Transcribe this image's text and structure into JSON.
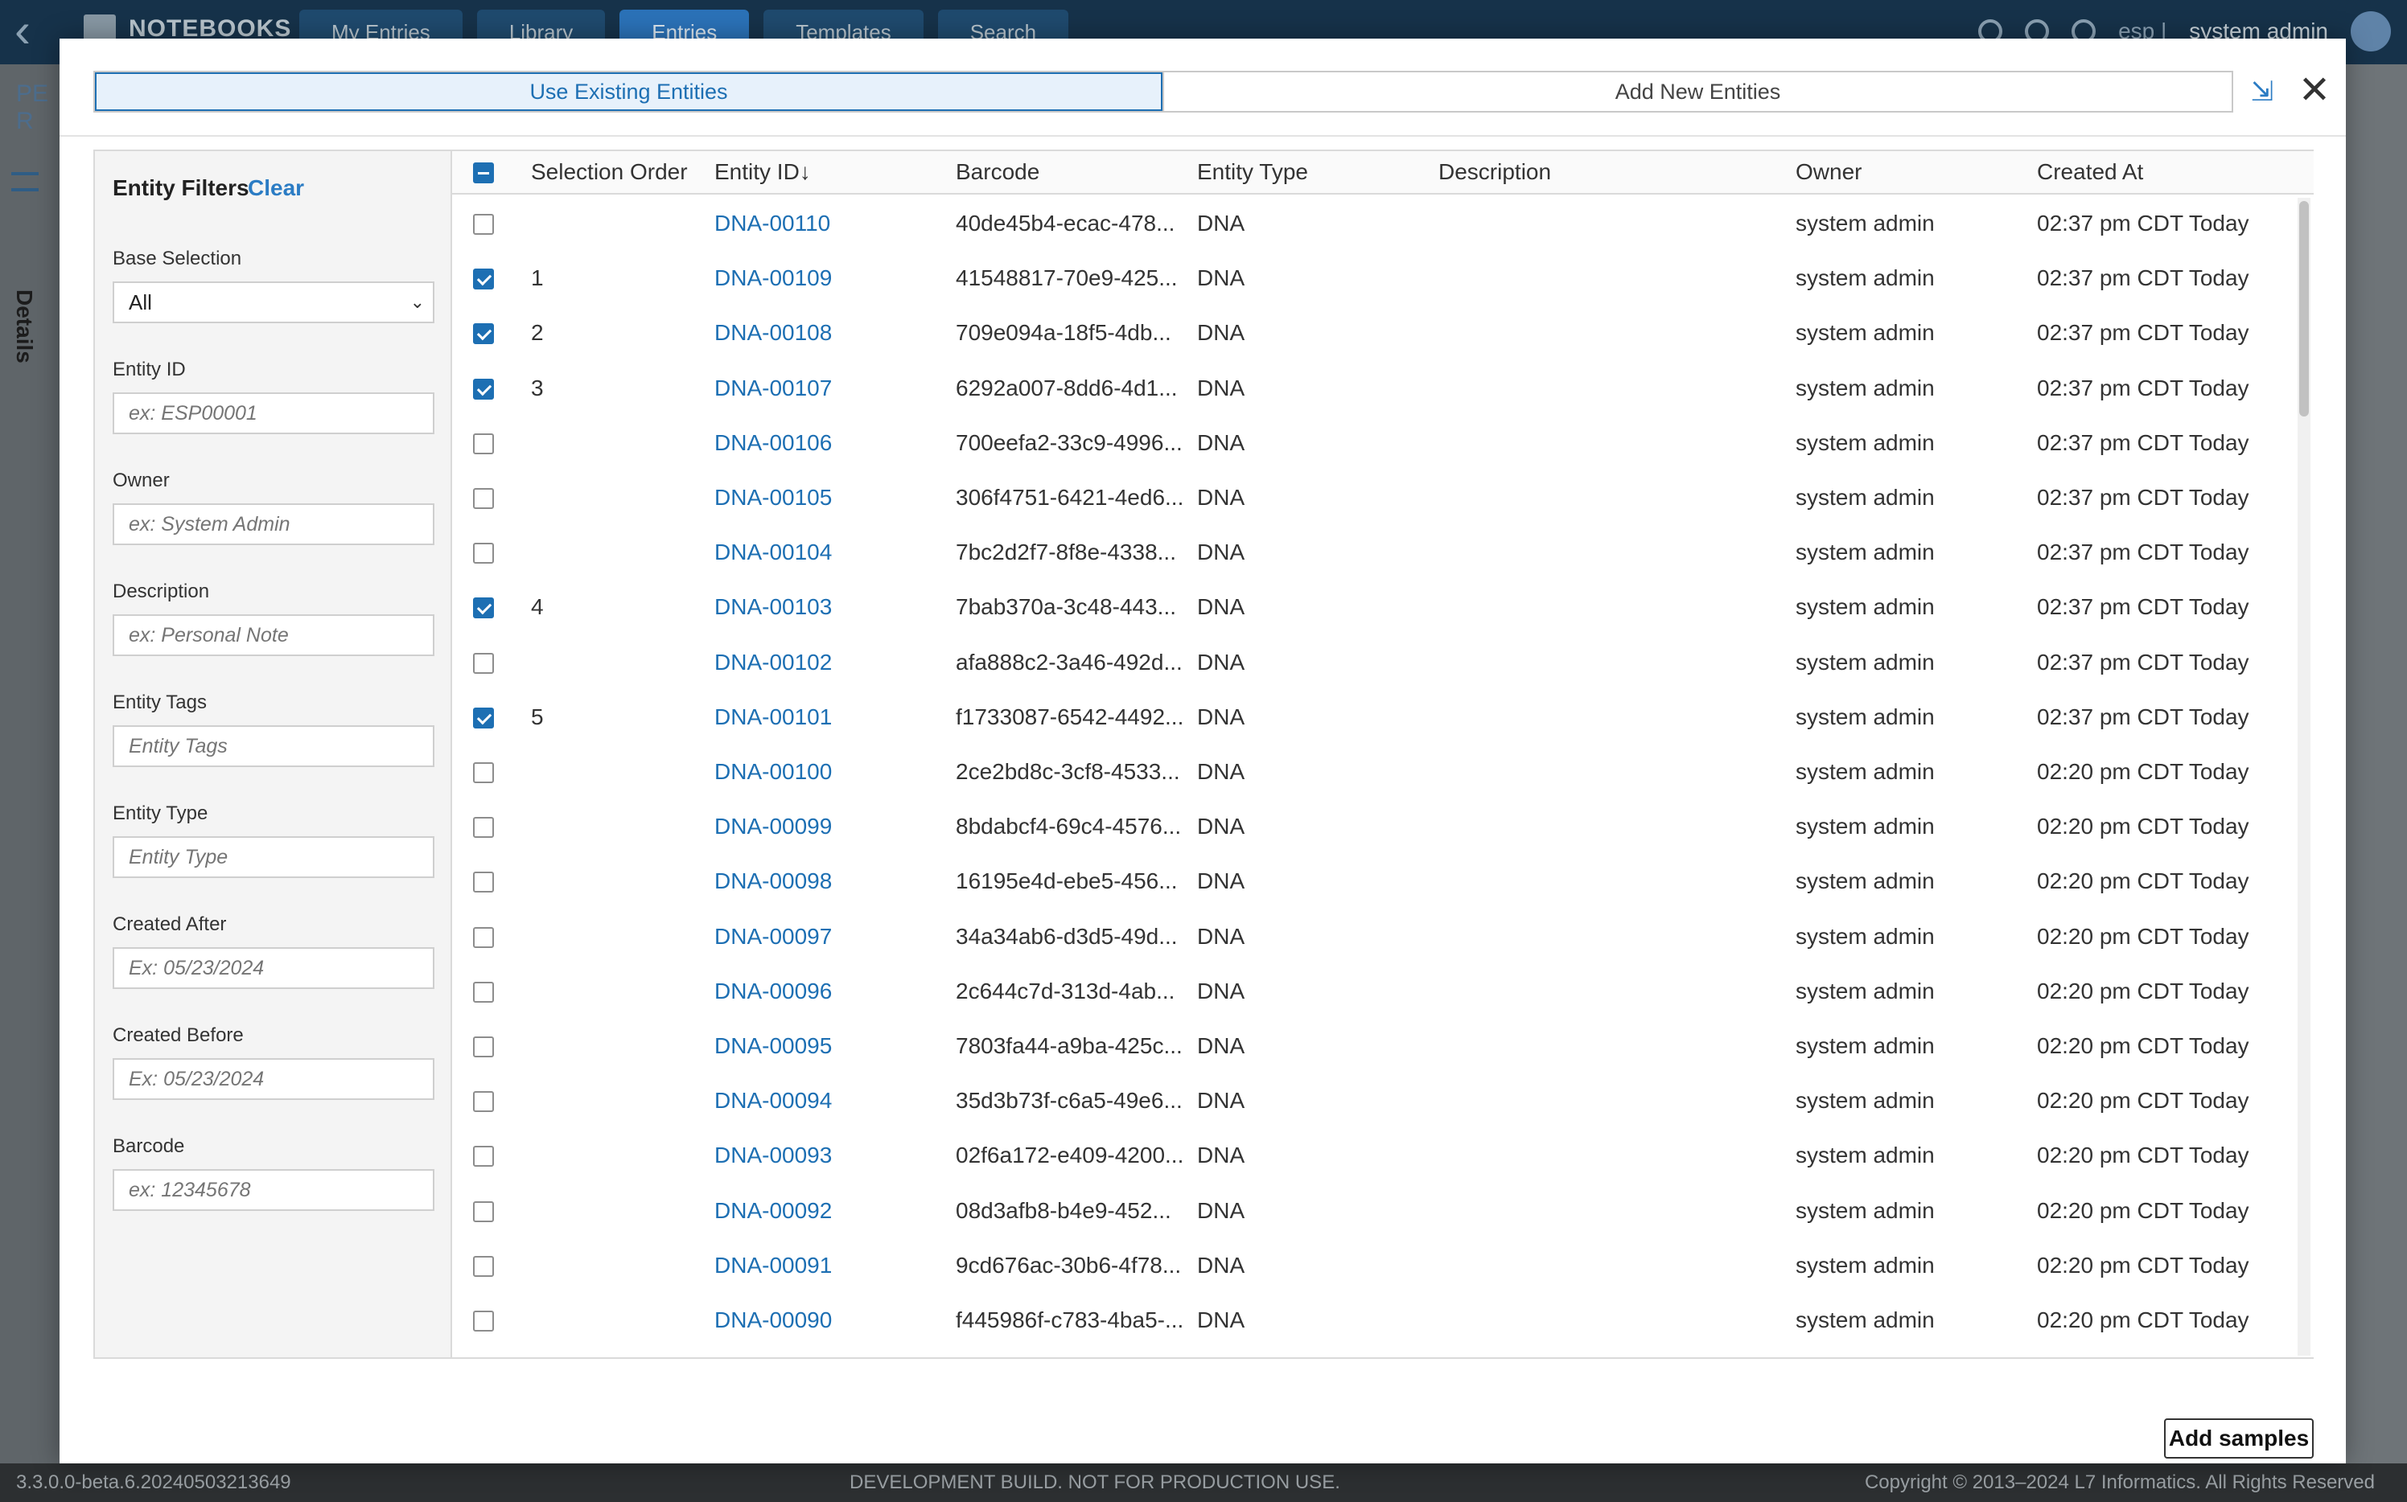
{
  "topbar": {
    "brand": "NOTEBOOKS",
    "tabs": [
      "My Entries",
      "Library",
      "Entries",
      "Templates",
      "Search"
    ],
    "active_tab": 2,
    "lang": "esp |",
    "user": "system admin"
  },
  "background": {
    "pe_label": "PE R",
    "details_label": "Details"
  },
  "modal": {
    "tabs": [
      "Use Existing Entities",
      "Add New Entities"
    ],
    "active_tab": 0,
    "close_glyph": "✕",
    "collapse_glyph": "⇲"
  },
  "filters": {
    "title": "Entity Filters",
    "clear": "Clear",
    "base_selection": {
      "label": "Base Selection",
      "value": "All"
    },
    "fields": [
      {
        "label": "Entity ID",
        "placeholder": "ex: ESP00001"
      },
      {
        "label": "Owner",
        "placeholder": "ex: System Admin"
      },
      {
        "label": "Description",
        "placeholder": "ex: Personal Note"
      },
      {
        "label": "Entity Tags",
        "placeholder": "Entity Tags"
      },
      {
        "label": "Entity Type",
        "placeholder": "Entity Type"
      },
      {
        "label": "Created After",
        "placeholder": "Ex: 05/23/2024"
      },
      {
        "label": "Created Before",
        "placeholder": "Ex: 05/23/2024"
      },
      {
        "label": "Barcode",
        "placeholder": "ex: 12345678"
      }
    ]
  },
  "table": {
    "columns": [
      "Selection Order",
      "Entity ID↓",
      "Barcode",
      "Entity Type",
      "Description",
      "Owner",
      "Created At"
    ],
    "rows": [
      {
        "checked": false,
        "order": "",
        "id": "DNA-00110",
        "barcode": "40de45b4-ecac-478...",
        "type": "DNA",
        "description": "",
        "owner": "system admin",
        "created": "02:37 pm CDT Today"
      },
      {
        "checked": true,
        "order": "1",
        "id": "DNA-00109",
        "barcode": "41548817-70e9-425...",
        "type": "DNA",
        "description": "",
        "owner": "system admin",
        "created": "02:37 pm CDT Today"
      },
      {
        "checked": true,
        "order": "2",
        "id": "DNA-00108",
        "barcode": "709e094a-18f5-4db...",
        "type": "DNA",
        "description": "",
        "owner": "system admin",
        "created": "02:37 pm CDT Today"
      },
      {
        "checked": true,
        "order": "3",
        "id": "DNA-00107",
        "barcode": "6292a007-8dd6-4d1...",
        "type": "DNA",
        "description": "",
        "owner": "system admin",
        "created": "02:37 pm CDT Today"
      },
      {
        "checked": false,
        "order": "",
        "id": "DNA-00106",
        "barcode": "700eefa2-33c9-4996...",
        "type": "DNA",
        "description": "",
        "owner": "system admin",
        "created": "02:37 pm CDT Today"
      },
      {
        "checked": false,
        "order": "",
        "id": "DNA-00105",
        "barcode": "306f4751-6421-4ed6...",
        "type": "DNA",
        "description": "",
        "owner": "system admin",
        "created": "02:37 pm CDT Today"
      },
      {
        "checked": false,
        "order": "",
        "id": "DNA-00104",
        "barcode": "7bc2d2f7-8f8e-4338...",
        "type": "DNA",
        "description": "",
        "owner": "system admin",
        "created": "02:37 pm CDT Today"
      },
      {
        "checked": true,
        "order": "4",
        "id": "DNA-00103",
        "barcode": "7bab370a-3c48-443...",
        "type": "DNA",
        "description": "",
        "owner": "system admin",
        "created": "02:37 pm CDT Today"
      },
      {
        "checked": false,
        "order": "",
        "id": "DNA-00102",
        "barcode": "afa888c2-3a46-492d...",
        "type": "DNA",
        "description": "",
        "owner": "system admin",
        "created": "02:37 pm CDT Today"
      },
      {
        "checked": true,
        "order": "5",
        "id": "DNA-00101",
        "barcode": "f1733087-6542-4492...",
        "type": "DNA",
        "description": "",
        "owner": "system admin",
        "created": "02:37 pm CDT Today"
      },
      {
        "checked": false,
        "order": "",
        "id": "DNA-00100",
        "barcode": "2ce2bd8c-3cf8-4533...",
        "type": "DNA",
        "description": "",
        "owner": "system admin",
        "created": "02:20 pm CDT Today"
      },
      {
        "checked": false,
        "order": "",
        "id": "DNA-00099",
        "barcode": "8bdabcf4-69c4-4576...",
        "type": "DNA",
        "description": "",
        "owner": "system admin",
        "created": "02:20 pm CDT Today"
      },
      {
        "checked": false,
        "order": "",
        "id": "DNA-00098",
        "barcode": "16195e4d-ebe5-456...",
        "type": "DNA",
        "description": "",
        "owner": "system admin",
        "created": "02:20 pm CDT Today"
      },
      {
        "checked": false,
        "order": "",
        "id": "DNA-00097",
        "barcode": "34a34ab6-d3d5-49d...",
        "type": "DNA",
        "description": "",
        "owner": "system admin",
        "created": "02:20 pm CDT Today"
      },
      {
        "checked": false,
        "order": "",
        "id": "DNA-00096",
        "barcode": "2c644c7d-313d-4ab...",
        "type": "DNA",
        "description": "",
        "owner": "system admin",
        "created": "02:20 pm CDT Today"
      },
      {
        "checked": false,
        "order": "",
        "id": "DNA-00095",
        "barcode": "7803fa44-a9ba-425c...",
        "type": "DNA",
        "description": "",
        "owner": "system admin",
        "created": "02:20 pm CDT Today"
      },
      {
        "checked": false,
        "order": "",
        "id": "DNA-00094",
        "barcode": "35d3b73f-c6a5-49e6...",
        "type": "DNA",
        "description": "",
        "owner": "system admin",
        "created": "02:20 pm CDT Today"
      },
      {
        "checked": false,
        "order": "",
        "id": "DNA-00093",
        "barcode": "02f6a172-e409-4200...",
        "type": "DNA",
        "description": "",
        "owner": "system admin",
        "created": "02:20 pm CDT Today"
      },
      {
        "checked": false,
        "order": "",
        "id": "DNA-00092",
        "barcode": "08d3afb8-b4e9-452...",
        "type": "DNA",
        "description": "",
        "owner": "system admin",
        "created": "02:20 pm CDT Today"
      },
      {
        "checked": false,
        "order": "",
        "id": "DNA-00091",
        "barcode": "9cd676ac-30b6-4f78...",
        "type": "DNA",
        "description": "",
        "owner": "system admin",
        "created": "02:20 pm CDT Today"
      },
      {
        "checked": false,
        "order": "",
        "id": "DNA-00090",
        "barcode": "f445986f-c783-4ba5-...",
        "type": "DNA",
        "description": "",
        "owner": "system admin",
        "created": "02:20 pm CDT Today"
      }
    ]
  },
  "actions": {
    "add_samples": "Add samples"
  },
  "footer": {
    "version": "3.3.0.0-beta.6.20240503213649",
    "dev_notice": "DEVELOPMENT BUILD. NOT FOR PRODUCTION USE.",
    "copyright": "Copyright © 2013–2024 L7 Informatics. All Rights Reserved"
  }
}
